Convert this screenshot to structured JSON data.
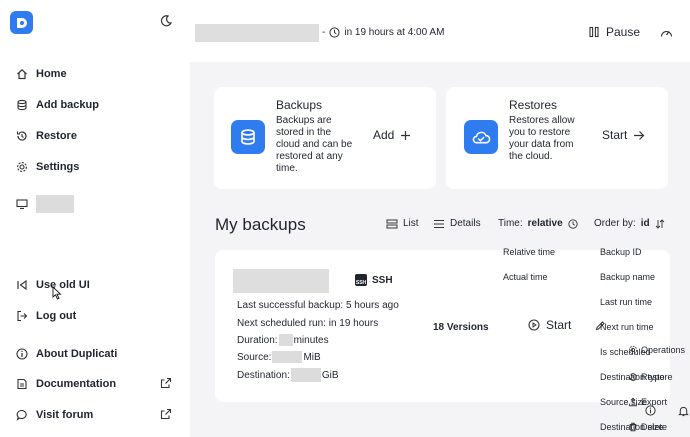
{
  "sidebar": {
    "nav": [
      {
        "label": "Home",
        "icon": "home-icon"
      },
      {
        "label": "Add backup",
        "icon": "database-icon"
      },
      {
        "label": "Restore",
        "icon": "history-icon"
      },
      {
        "label": "Settings",
        "icon": "gear-icon"
      }
    ],
    "bottom": [
      {
        "label": "Use old UI",
        "icon": "back-arrow-icon"
      },
      {
        "label": "Log out",
        "icon": "logout-icon"
      },
      {
        "label": "About Duplicati",
        "icon": "info-icon"
      },
      {
        "label": "Documentation",
        "icon": "document-icon"
      },
      {
        "label": "Visit forum",
        "icon": "chat-icon"
      }
    ]
  },
  "header": {
    "separator": "-",
    "schedule": "in 19 hours at 4:00 AM",
    "pause_label": "Pause"
  },
  "cards": {
    "backups": {
      "title": "Backups",
      "desc": [
        "Backups are",
        "stored in the",
        "cloud and can be",
        "restored at any",
        "time."
      ],
      "action": "Add"
    },
    "restores": {
      "title": "Restores",
      "desc": [
        "Restores allow",
        "you to restore",
        "your data from",
        "the cloud."
      ],
      "action": "Start"
    }
  },
  "main": {
    "heading": "My backups",
    "list_label": "List",
    "details_label": "Details",
    "time_label": "Time:",
    "time_value": "relative",
    "order_label": "Order by:",
    "order_value": "id"
  },
  "backup": {
    "type": "SSH",
    "badge": "SSH",
    "last_success": "Last successful backup: 5 hours ago",
    "next_run": "Next scheduled run: in 19 hours",
    "duration_label": "Duration:",
    "duration_unit": "minutes",
    "source_label": "Source:",
    "source_unit": "MiB",
    "destination_label": "Destination:",
    "destination_unit": "GiB",
    "versions": "18 Versions",
    "start_label": "Start"
  },
  "time_options": [
    "Relative time",
    "Actual time"
  ],
  "order_options": [
    "Backup ID",
    "Backup name",
    "Last run time",
    "Next run time",
    "Is scheduled",
    "Destination type",
    "Source size",
    "Destination size"
  ],
  "operations": {
    "title": "Operations",
    "restore": "Restore",
    "export": "Export",
    "delete": "Delete"
  }
}
